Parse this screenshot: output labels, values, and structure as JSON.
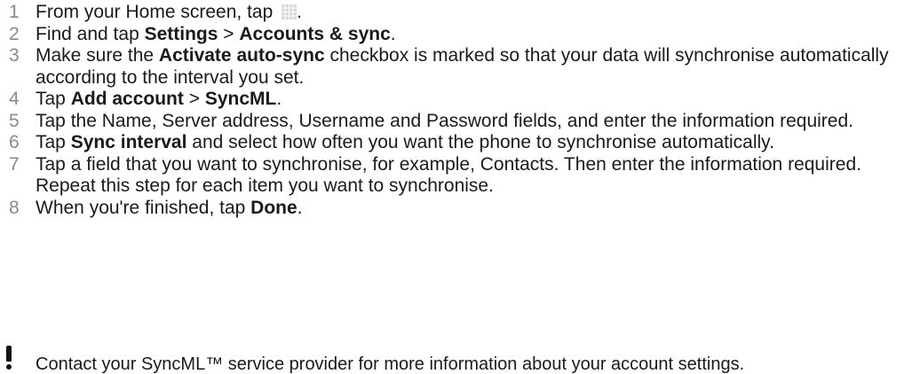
{
  "heading": "",
  "steps": [
    {
      "num": "1",
      "parts": [
        "From your Home screen, tap ",
        "."
      ]
    },
    {
      "num": "2",
      "parts": [
        "Find and tap ",
        "Settings",
        " > ",
        "Accounts & sync",
        "."
      ]
    },
    {
      "num": "3",
      "parts": [
        "Make sure the ",
        "Activate auto-sync",
        " checkbox is marked so that your data will synchronise automatically according to the interval you set."
      ]
    },
    {
      "num": "4",
      "parts": [
        "Tap ",
        "Add account",
        " > ",
        "SyncML",
        "."
      ]
    },
    {
      "num": "5",
      "parts": [
        "Tap the Name, Server address, Username and Password fields, and enter the information required."
      ]
    },
    {
      "num": "6",
      "parts": [
        "Tap ",
        "Sync interval",
        " and select how often you want the phone to synchronise automatically."
      ]
    },
    {
      "num": "7",
      "parts": [
        "Tap a field that you want to synchronise, for example, Contacts. Then enter the information required. Repeat this step for each item you want to synchronise."
      ]
    },
    {
      "num": "8",
      "parts": [
        "When you're finished, tap ",
        "Done",
        "."
      ]
    }
  ],
  "note": {
    "icon": "exclamation-icon",
    "text": "Contact your SyncML™ service provider for more information about your account settings."
  },
  "colors": {
    "heading": "#00a0e3",
    "step_number": "#8a8a8a",
    "text": "#1a1a1a"
  }
}
